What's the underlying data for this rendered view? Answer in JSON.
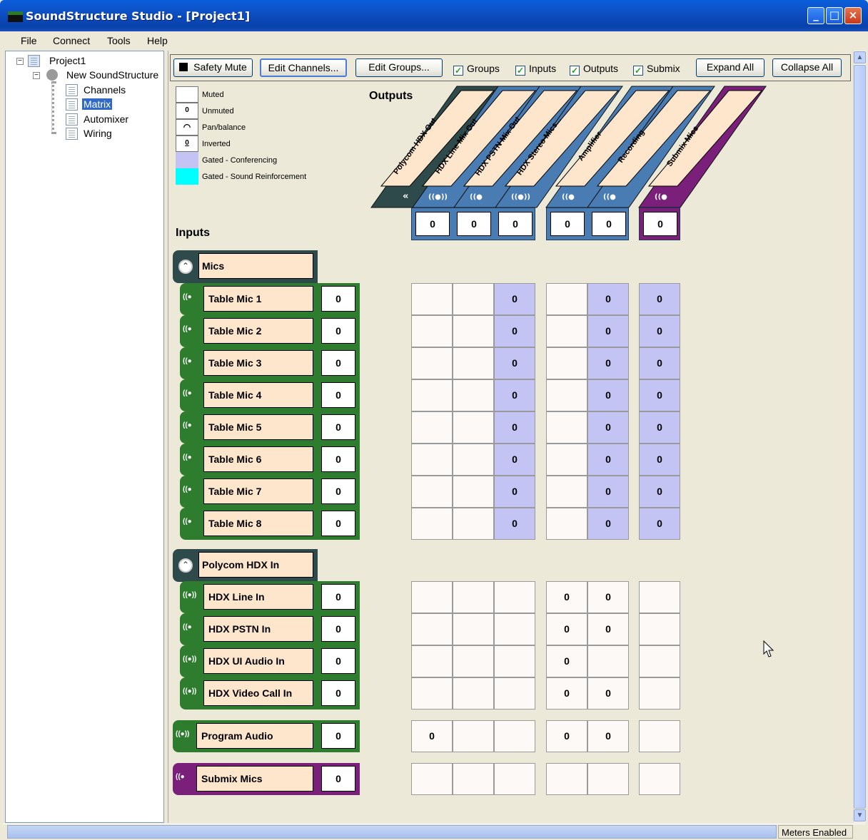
{
  "window": {
    "title": "SoundStructure Studio - [Project1]",
    "min": "_",
    "max": "□",
    "close": "×"
  },
  "menu": [
    "File",
    "Connect",
    "Tools",
    "Help"
  ],
  "tree": {
    "root": "Project1",
    "device": "New SoundStructure",
    "items": [
      "Channels",
      "Matrix",
      "Automixer",
      "Wiring"
    ],
    "selected": "Matrix"
  },
  "toolbar": {
    "safety_mute": "Safety Mute",
    "edit_channels": "Edit Channels...",
    "edit_groups": "Edit Groups...",
    "checkboxes": [
      "Groups",
      "Inputs",
      "Outputs",
      "Submix"
    ],
    "check_mark": "✓",
    "expand_all": "Expand All",
    "collapse_all": "Collapse All"
  },
  "legend": [
    {
      "label": "Muted",
      "symbol": ""
    },
    {
      "label": "Unmuted",
      "symbol": "0"
    },
    {
      "label": "Pan/balance",
      "symbol": "◠"
    },
    {
      "label": "Inverted",
      "symbol": "0"
    },
    {
      "label": "Gated - Conferencing",
      "symbol": ""
    },
    {
      "label": "Gated - Sound Reinforcement",
      "symbol": ""
    }
  ],
  "colors": {
    "gated_conferencing": "#C4C4F4",
    "gated_sound_reinforcement": "#00FFFF",
    "mic_group": "#2E7D2E",
    "submix": "#7A1F7A",
    "output_blue": "#4A7CB4",
    "header_dark": "#2F4A4A"
  },
  "labels": {
    "outputs": "Outputs",
    "inputs": "Inputs"
  },
  "outputs": [
    {
      "name": "Polycom HDX Out",
      "gain": "",
      "wave": "«"
    },
    {
      "name": "HDX Line Mix Out",
      "gain": "0",
      "wave": "((●))"
    },
    {
      "name": "HDX PSTN Mix Out",
      "gain": "0",
      "wave": "((●"
    },
    {
      "name": "HDX Stereo Mics...",
      "gain": "0",
      "wave": "((●))"
    },
    {
      "name": "Amplifier",
      "gain": "0",
      "wave": "((●"
    },
    {
      "name": "Recording",
      "gain": "0",
      "wave": "((●"
    },
    {
      "name": "Submix Mics",
      "gain": "0",
      "wave": "((●"
    }
  ],
  "groups": [
    {
      "name": "Mics",
      "collapse": "⌃"
    },
    {
      "name": "Polycom HDX In",
      "collapse": "⌃"
    }
  ],
  "inputs": [
    {
      "name": "Table Mic 1",
      "gain": "0",
      "wave": "((●",
      "cells": [
        "",
        "",
        "0",
        "",
        "0",
        "0"
      ],
      "gated": [
        false,
        false,
        true,
        false,
        true,
        true
      ]
    },
    {
      "name": "Table Mic 2",
      "gain": "0",
      "wave": "((●",
      "cells": [
        "",
        "",
        "0",
        "",
        "0",
        "0"
      ],
      "gated": [
        false,
        false,
        true,
        false,
        true,
        true
      ]
    },
    {
      "name": "Table Mic 3",
      "gain": "0",
      "wave": "((●",
      "cells": [
        "",
        "",
        "0",
        "",
        "0",
        "0"
      ],
      "gated": [
        false,
        false,
        true,
        false,
        true,
        true
      ]
    },
    {
      "name": "Table Mic 4",
      "gain": "0",
      "wave": "((●",
      "cells": [
        "",
        "",
        "0",
        "",
        "0",
        "0"
      ],
      "gated": [
        false,
        false,
        true,
        false,
        true,
        true
      ]
    },
    {
      "name": "Table Mic 5",
      "gain": "0",
      "wave": "((●",
      "cells": [
        "",
        "",
        "0",
        "",
        "0",
        "0"
      ],
      "gated": [
        false,
        false,
        true,
        false,
        true,
        true
      ]
    },
    {
      "name": "Table Mic 6",
      "gain": "0",
      "wave": "((●",
      "cells": [
        "",
        "",
        "0",
        "",
        "0",
        "0"
      ],
      "gated": [
        false,
        false,
        true,
        false,
        true,
        true
      ]
    },
    {
      "name": "Table Mic 7",
      "gain": "0",
      "wave": "((●",
      "cells": [
        "",
        "",
        "0",
        "",
        "0",
        "0"
      ],
      "gated": [
        false,
        false,
        true,
        false,
        true,
        true
      ]
    },
    {
      "name": "Table Mic 8",
      "gain": "0",
      "wave": "((●",
      "cells": [
        "",
        "",
        "0",
        "",
        "0",
        "0"
      ],
      "gated": [
        false,
        false,
        true,
        false,
        true,
        true
      ]
    },
    {
      "name": "HDX Line In",
      "gain": "0",
      "wave": "((●))",
      "cells": [
        "",
        "",
        "",
        "0",
        "0",
        ""
      ],
      "gated": [
        false,
        false,
        false,
        false,
        false,
        false
      ]
    },
    {
      "name": "HDX PSTN In",
      "gain": "0",
      "wave": "((●",
      "cells": [
        "",
        "",
        "",
        "0",
        "0",
        ""
      ],
      "gated": [
        false,
        false,
        false,
        false,
        false,
        false
      ]
    },
    {
      "name": "HDX UI Audio In",
      "gain": "0",
      "wave": "((●))",
      "cells": [
        "",
        "",
        "",
        "0",
        "",
        ""
      ],
      "gated": [
        false,
        false,
        false,
        false,
        false,
        false
      ]
    },
    {
      "name": "HDX Video Call In",
      "gain": "0",
      "wave": "((●))",
      "cells": [
        "",
        "",
        "",
        "0",
        "0",
        ""
      ],
      "gated": [
        false,
        false,
        false,
        false,
        false,
        false
      ]
    },
    {
      "name": "Program Audio",
      "gain": "0",
      "wave": "((●))",
      "cells": [
        "0",
        "",
        "",
        "0",
        "0",
        ""
      ],
      "gated": [
        false,
        false,
        false,
        false,
        false,
        false
      ]
    },
    {
      "name": "Submix Mics",
      "gain": "0",
      "wave": "((●",
      "cells": [
        "",
        "",
        "",
        "",
        "",
        ""
      ],
      "gated": [
        false,
        false,
        false,
        false,
        false,
        false
      ]
    }
  ],
  "status": {
    "meters": "Meters Enabled"
  }
}
